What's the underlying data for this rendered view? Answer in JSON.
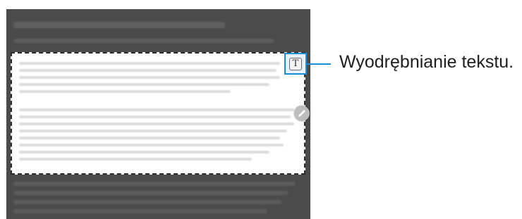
{
  "callout": {
    "label": "Wyodrębnianie tekstu.",
    "line_color": "#1a8ed6"
  },
  "text_extraction_button": {
    "glyph": "T",
    "icon": "text-extraction-icon"
  },
  "edit_handle": {
    "icon": "pen-icon"
  },
  "colors": {
    "screen_background": "#4b4b4b",
    "selection_background": "#ffffff",
    "highlight": "#1a8ed6"
  }
}
